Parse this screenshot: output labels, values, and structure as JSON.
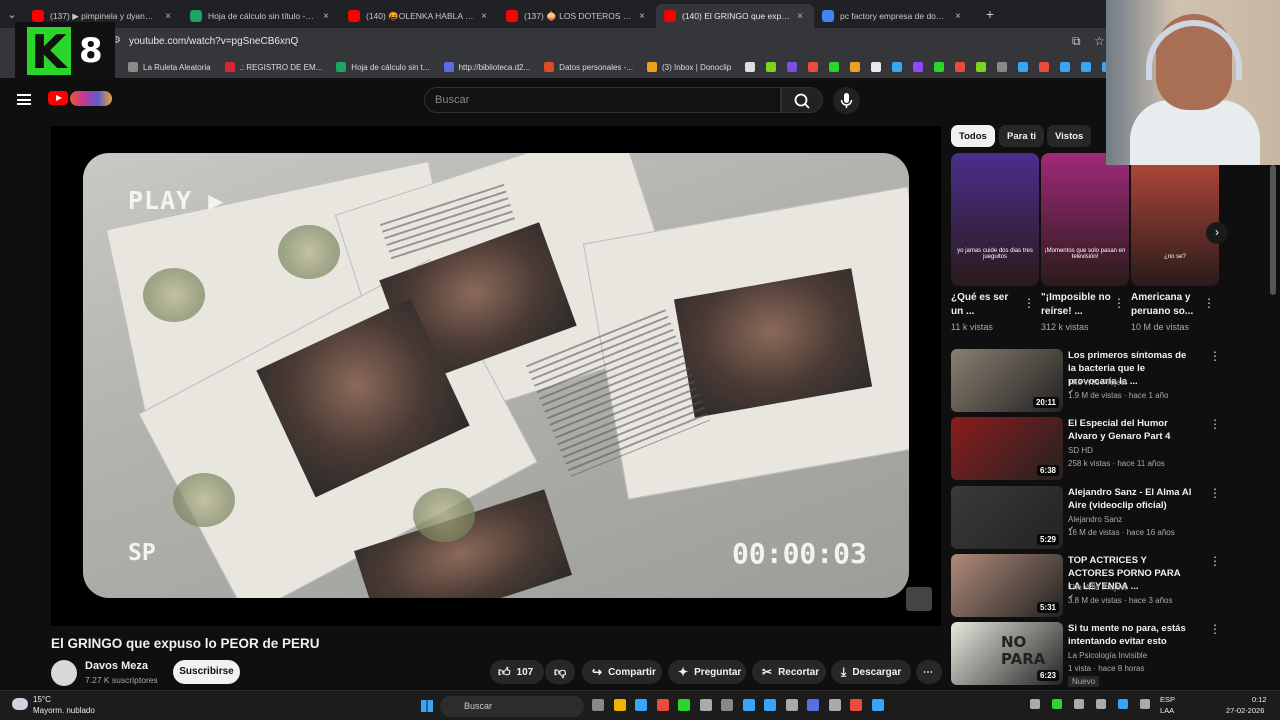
{
  "browser": {
    "tabs": [
      {
        "label": "(137) ▶ pimpinela y dyango po",
        "color": "#ff0000",
        "active": false
      },
      {
        "label": "Hoja de cálculo sin título - Hoja",
        "color": "#1fa463",
        "active": false
      },
      {
        "label": "(140) 🤬OLENKA HABLA DE RE",
        "color": "#ff0000",
        "active": false
      },
      {
        "label": "(137) 🧅 LOS DOTEROS NUNCA",
        "color": "#ff0000",
        "active": false
      },
      {
        "label": "(140) El GRINGO que expuso lo",
        "color": "#ff0000",
        "active": true
      },
      {
        "label": "pc factory empresa de donde e",
        "color": "#4285f4",
        "active": false
      }
    ],
    "tab_close": "×",
    "new_tab": "+",
    "url": "youtube.com/watch?v=pgSneCB6xnQ",
    "bookmarks": [
      {
        "label": "La Ruleta Aleatoria",
        "color": "#8a8a8a"
      },
      {
        "label": ".: REGISTRO DE EM...",
        "color": "#d23"
      },
      {
        "label": "Hoja de cálculo sin t...",
        "color": "#1fa463"
      },
      {
        "label": "http://biblioteca.d2...",
        "color": "#5b6ee1"
      },
      {
        "label": "Datos personales -...",
        "color": "#e04a2a"
      },
      {
        "label": "(3) Inbox | Donoclip",
        "color": "#f0a020"
      }
    ],
    "bookmark_icon_colors": [
      "#ddd",
      "#7ed321",
      "#7b4fe0",
      "#e74c3c",
      "#2bd62b",
      "#f0a020",
      "#e8e8e8",
      "#3aa4f5",
      "#9146ff",
      "#2bd62b",
      "#e74c3c",
      "#7ed321",
      "#888",
      "#3aa4f5",
      "#e74c3c",
      "#3aa4f5",
      "#3aa4f5",
      "#3aa4f5",
      "#3aa4f5",
      "#25d366",
      "#f5d400"
    ]
  },
  "overlay": {
    "k8_text": "8"
  },
  "youtube": {
    "search_placeholder": "Buscar",
    "video_overlay": {
      "play": "PLAY ▶",
      "sp": "SP",
      "timecode": "00:00:03"
    },
    "title": "El GRINGO que expuso lo PEOR de PERU",
    "channel": {
      "name": "Davos Meza",
      "subs": "7.27 K suscriptores",
      "subscribe": "Suscribirse"
    },
    "actions": {
      "likes": "107",
      "share": "Compartir",
      "ask": "Preguntar",
      "clip": "Recortar",
      "download": "Descargar",
      "more": "⋯"
    },
    "chips": [
      "Todos",
      "Para ti",
      "Vistos"
    ],
    "shorts": [
      {
        "title": "¿Qué es ser un ...",
        "views": "11 k vistas",
        "caption": "yo jamas cuide dos dias tres jueguitos",
        "bg": "#4b2e8c"
      },
      {
        "title": "\"¡Imposible no reírse! ...",
        "views": "312 k vistas",
        "caption": "¡Momentos que solo pasan en televisión!",
        "bg": "#a02a7a"
      },
      {
        "title": "Americana y peruano so...",
        "views": "10 M de vistas",
        "caption": "¿no se?",
        "bg": "#b84a3a"
      }
    ],
    "recommendations": [
      {
        "title": "Los primeros síntomas de la bacteria que le provocaría la ...",
        "channel": "The Wild Project",
        "meta": "1.9 M de vistas · hace 1 año",
        "duration": "20:11",
        "bg": "#8a7f70",
        "verified": true
      },
      {
        "title": "El Especial del Humor Alvaro y Genaro Part 4",
        "channel": "SD HD",
        "meta": "258 k vistas · hace 11 años",
        "duration": "6:38",
        "bg": "#8c1c1c",
        "verified": false
      },
      {
        "title": "Alejandro Sanz - El Alma Al Aire (videoclip oficial)",
        "channel": "Alejandro Sanz",
        "meta": "16 M de vistas · hace 16 años",
        "duration": "5:29",
        "bg": "#3a3a3a",
        "verified": true
      },
      {
        "title": "TOP ACTRICES Y ACTORES PORNO PARA LA LEYENDA ...",
        "channel": "The Wild Project",
        "meta": "3.8 M de vistas · hace 3 años",
        "duration": "5:31",
        "bg": "#b08a7a",
        "verified": true
      },
      {
        "title": "Si tu mente no para, estás intentando evitar esto",
        "channel": "La Psicología Invisible",
        "meta": "1 vista · hace 8 horas",
        "duration": "6:23",
        "bg": "#e8e8e0",
        "verified": false,
        "badge": "Nuevo",
        "thumb_text": "NO PARA"
      }
    ]
  },
  "taskbar": {
    "temp": "15°C",
    "weather": "Mayorm. nublado",
    "search": "Buscar",
    "lang1": "ESP",
    "lang2": "LAA",
    "time": "0:12",
    "date": "27-02-2026",
    "app_colors": [
      "#888",
      "#f0b400",
      "#3aa4f5",
      "#e74c3c",
      "#2bd62b",
      "#aaa",
      "#888",
      "#3aa4f5",
      "#3aa4f5",
      "#aaa",
      "#5b6ee1",
      "#aaa",
      "#e74c3c",
      "#3aa4f5"
    ],
    "tray_colors": [
      "#aaa",
      "#2bd62b",
      "#aaa",
      "#aaa",
      "#3aa4f5",
      "#aaa"
    ]
  }
}
